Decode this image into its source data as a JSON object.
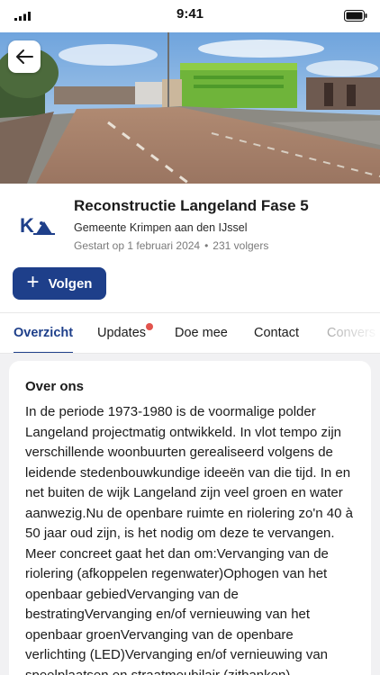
{
  "status": {
    "time": "9:41"
  },
  "hero": {
    "back_icon": "arrow-left-icon"
  },
  "project": {
    "logo_text": "K",
    "title": "Reconstructie Langeland Fase 5",
    "organization": "Gemeente Krimpen aan den IJssel",
    "started": "Gestart op 1 februari 2024",
    "separator": "•",
    "followers": "231 volgers"
  },
  "follow_button": {
    "icon": "plus-icon",
    "label": "Volgen"
  },
  "tabs": [
    {
      "label": "Overzicht",
      "active": true
    },
    {
      "label": "Updates",
      "badge": true
    },
    {
      "label": "Doe mee"
    },
    {
      "label": "Contact"
    },
    {
      "label": "Convers"
    }
  ],
  "about": {
    "heading": "Over ons",
    "body": "In de periode 1973-1980 is de voormalige polder Langeland projectmatig ontwikkeld. In vlot tempo zijn verschillende woonbuurten gerealiseerd volgens de leidende stedenbouwkundige ideeën van die tijd. In en net buiten de wijk Langeland zijn veel groen en water aanwezig.Nu de openbare ruimte en riolering zo'n 40 à 50 jaar oud zijn, is het nodig om deze te vervangen. Meer concreet gaat het dan om:Vervanging van de riolering (afkoppelen regenwater)Ophogen van het openbaar gebiedVervanging van de bestratingVervanging en/of vernieuwing van het openbaar groenVervanging van de openbare verlichting (LED)Vervanging en/of vernieuwing van speelplaatsen en straatmeubilair (zitbanken)"
  },
  "colors": {
    "primary": "#1e3f8a",
    "badge": "#e2534d",
    "page_bg": "#f1f1f3"
  }
}
